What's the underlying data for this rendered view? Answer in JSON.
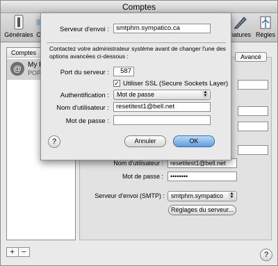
{
  "window": {
    "title": "Comptes"
  },
  "toolbar": {
    "generales": "Générales",
    "clipped": "Co",
    "signatures": "natures",
    "regles": "Règles"
  },
  "accounts": {
    "header": "Comptes",
    "item": {
      "name": "My Er",
      "type": "POP"
    }
  },
  "panel": {
    "tab_avance": "Avancé",
    "user_label": "Nom d'utilisateur :",
    "user_value": "resetitest1@bell.net",
    "password_label": "Mot de passe :",
    "password_value": "••••••••",
    "smtp_label": "Serveur d'envoi (SMTP) :",
    "smtp_value": "smtphm.sympatico",
    "server_settings_button": "Réglages du serveur..."
  },
  "sheet": {
    "server_label": "Serveur d'envoi :",
    "server_value": "smtphm.sympatico.ca",
    "warning": "Contactez votre administrateur système avant de changer l'une des options avancées ci-dessous :",
    "port_label": "Port du serveur :",
    "port_value": "587",
    "ssl_label": "Utiliser SSL (Secure Sockets Layer)",
    "ssl_check": "✓",
    "auth_label": "Authentification :",
    "auth_value": "Mot de passe",
    "user_label": "Nom d'utilisateur :",
    "user_value": "resetitest1@bell.net",
    "password_label": "Mot de passe :",
    "password_value": "",
    "cancel_label": "Annuler",
    "ok_label": "OK",
    "help": "?"
  },
  "footer": {
    "plus": "+",
    "minus": "−",
    "help": "?"
  }
}
